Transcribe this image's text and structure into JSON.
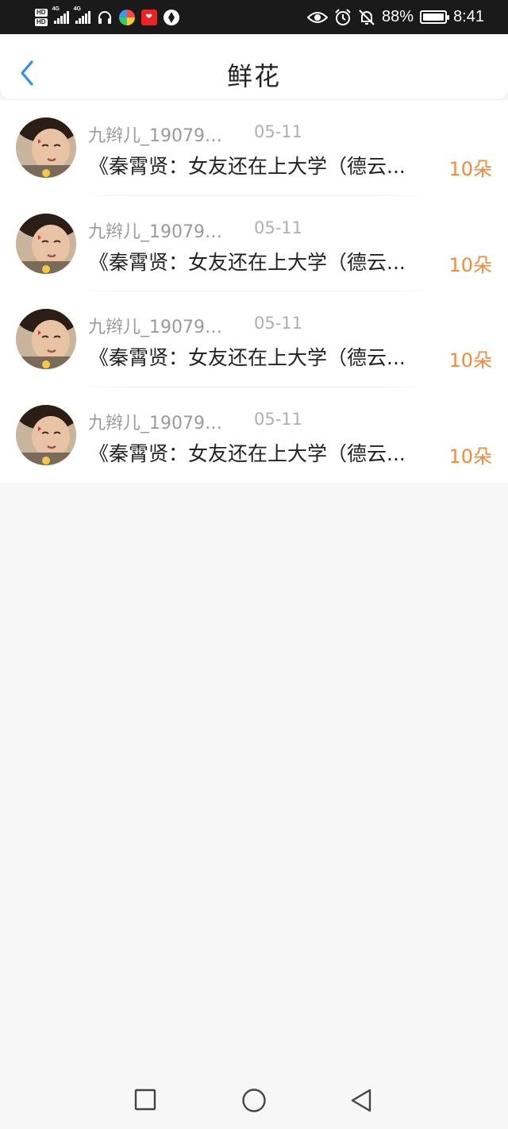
{
  "status_bar": {
    "hd1": "HD",
    "hd2": "HD",
    "net1": "4G",
    "net2": "4G",
    "battery_percent": "88%",
    "time": "8:41",
    "icons": [
      "headphone-icon",
      "app-icon",
      "app-icon",
      "app-icon",
      "eye-icon",
      "alarm-icon",
      "mute-icon",
      "battery-icon"
    ]
  },
  "header": {
    "title": "鲜花",
    "back_icon": "chevron-left-icon",
    "accent": "#2f8fe6"
  },
  "items": [
    {
      "name": "九辫儿_190795...",
      "date": "05-11",
      "desc": "《秦霄贤：女友还在上大学（德云...",
      "count": "10朵"
    },
    {
      "name": "九辫儿_190795...",
      "date": "05-11",
      "desc": "《秦霄贤：女友还在上大学（德云...",
      "count": "10朵"
    },
    {
      "name": "九辫儿_190795...",
      "date": "05-11",
      "desc": "《秦霄贤：女友还在上大学（德云...",
      "count": "10朵"
    },
    {
      "name": "九辫儿_190795...",
      "date": "05-11",
      "desc": "《秦霄贤：女友还在上大学（德云...",
      "count": "10朵"
    }
  ],
  "colors": {
    "count": "#f28b3d",
    "name": "#9a9a9a",
    "background": "#f8f7f8"
  },
  "nav": {
    "icons": [
      "square-icon",
      "circle-icon",
      "triangle-back-icon"
    ]
  }
}
